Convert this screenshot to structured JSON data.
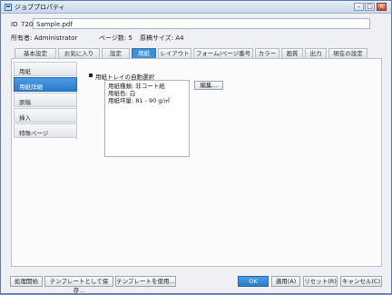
{
  "window": {
    "title": "ジョブプロパティ"
  },
  "header": {
    "id_label": "ID",
    "id_value": "720",
    "file_name": "Sample.pdf",
    "owner": "所有者: Administrator",
    "pages": "ページ数: 5",
    "original_size": "原稿サイズ: A4"
  },
  "tabs": [
    {
      "label": "基本設定"
    },
    {
      "label": "お気に入り"
    },
    {
      "label": "設定"
    },
    {
      "label": "用紙",
      "active": true
    },
    {
      "label": "レイアウト"
    },
    {
      "label": "フォーム/ページ番号"
    },
    {
      "label": "カラー"
    },
    {
      "label": "画質"
    },
    {
      "label": "出力"
    },
    {
      "label": "現在の設定"
    }
  ],
  "side_nav": [
    {
      "label": "用紙"
    },
    {
      "label": "用紙詳細",
      "active": true
    },
    {
      "label": "原稿"
    },
    {
      "label": "挿入"
    },
    {
      "label": "特殊ページ"
    }
  ],
  "paper": {
    "auto_tray_label": "用紙トレイの自動選択",
    "info_lines": [
      "用紙種類: 非コート紙",
      "用紙色: 白",
      "用紙坪量: 81 - 90 g/㎡"
    ],
    "edit_button": "編集..."
  },
  "footer": {
    "process_start": "処理開始",
    "save_template": "テンプレートとして保存...",
    "use_template": "テンプレートを使用...",
    "ok": "OK",
    "apply": "適用(A)",
    "reset": "リセット(R)",
    "cancel": "キャンセル(C)"
  },
  "colors": {
    "accent": "#3f8fd8",
    "window_border": "#5b7aa6"
  }
}
